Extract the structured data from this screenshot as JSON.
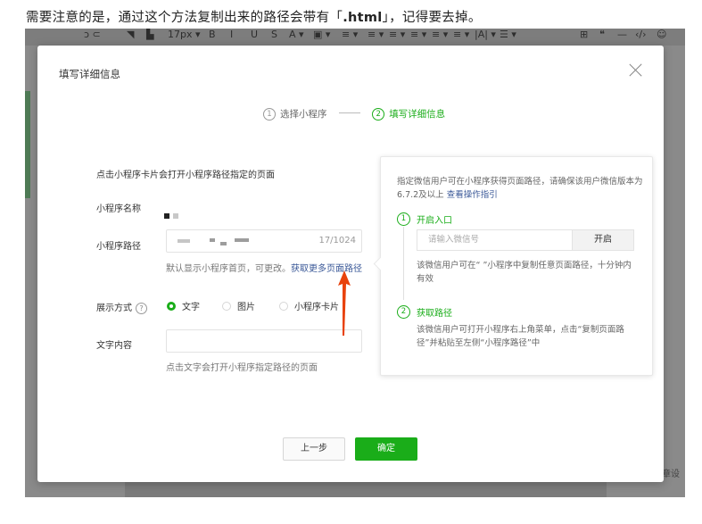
{
  "top_note": {
    "prefix": "需要注意的是，通过这个方法复制出来的路径会带有「",
    "code": ".html",
    "suffix": "」，记得要去掉。"
  },
  "toolbar": {
    "items": [
      "ɔ  ⊂",
      "◥",
      "▙",
      "17px ▾",
      "B",
      "I",
      "U",
      "S",
      "A ▾",
      "▣ ▾",
      "≡ ▾",
      "≡ ▾",
      "≡ ▾",
      "≡ ▾",
      "≡ ▾",
      "≡ ▾",
      "|A| ▾",
      "☰ ▾",
      "⊞",
      "❝",
      "—",
      "‹/›",
      "☺"
    ]
  },
  "right_hint": "文章设",
  "dialog": {
    "title": "填写详细信息",
    "steps": [
      {
        "num": "1",
        "label": "选择小程序",
        "state": "inactive"
      },
      {
        "num": "2",
        "label": "填写详细信息",
        "state": "active"
      }
    ],
    "intro": "点击小程序卡片会打开小程序路径指定的页面",
    "mini_name_label": "小程序名称",
    "mini_path_label": "小程序路径",
    "path_counter": "17/1024",
    "path_hint": "默认显示小程序首页，可更改。",
    "path_link": "获取更多页面路径",
    "display_label": "展示方式",
    "help_icon": "?",
    "display_options": [
      {
        "label": "文字",
        "checked": true
      },
      {
        "label": "图片",
        "checked": false
      },
      {
        "label": "小程序卡片",
        "checked": false
      }
    ],
    "text_label": "文字内容",
    "text_hint": "点击文字会打开小程序指定路径的页面",
    "prev_button": "上一步",
    "ok_button": "确定"
  },
  "popover": {
    "desc": "指定微信用户可在小程序获得页面路径，请确保该用户微信版本为6.7.2及以上",
    "desc_link": "查看操作指引",
    "step1_num": "1",
    "step1": "开启入口",
    "wx_placeholder": "请输入微信号",
    "open_button": "开启",
    "step1_text": "该微信用户可在“     ”小程序中复制任意页面路径，十分钟内有效",
    "step2_num": "2",
    "step2": "获取路径",
    "step2_text": "该微信用户可打开小程序右上角菜单，点击“复制页面路径”并粘贴至左侧“小程序路径”中"
  },
  "colors": {
    "accent": "#1aad19",
    "link": "#3b5998",
    "arrow": "#e8420c"
  }
}
